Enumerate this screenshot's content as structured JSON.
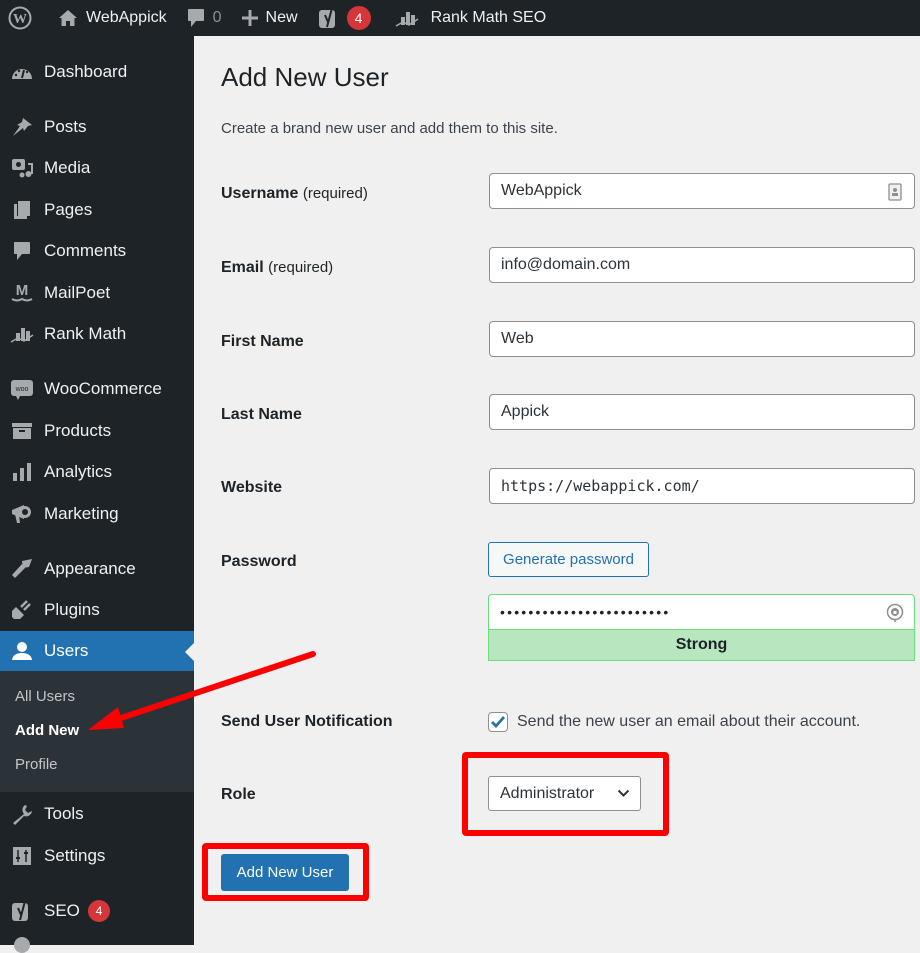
{
  "adminbar": {
    "site_name": "WebAppick",
    "comments_count": "0",
    "new_label": "New",
    "yoast_badge": "4",
    "rank_math_label": "Rank Math SEO"
  },
  "sidebar": {
    "items": [
      {
        "label": "Dashboard",
        "icon": "dashboard-icon"
      },
      {
        "label": "Posts",
        "icon": "pin-icon"
      },
      {
        "label": "Media",
        "icon": "media-icon"
      },
      {
        "label": "Pages",
        "icon": "pages-icon"
      },
      {
        "label": "Comments",
        "icon": "comment-icon"
      },
      {
        "label": "MailPoet",
        "icon": "mailpoet-icon"
      },
      {
        "label": "Rank Math",
        "icon": "rank-math-icon"
      },
      {
        "label": "WooCommerce",
        "icon": "woo-icon"
      },
      {
        "label": "Products",
        "icon": "archive-icon"
      },
      {
        "label": "Analytics",
        "icon": "bar-chart-icon"
      },
      {
        "label": "Marketing",
        "icon": "megaphone-icon"
      },
      {
        "label": "Appearance",
        "icon": "brush-icon"
      },
      {
        "label": "Plugins",
        "icon": "plug-icon"
      },
      {
        "label": "Users",
        "icon": "user-icon"
      },
      {
        "label": "Tools",
        "icon": "wrench-icon"
      },
      {
        "label": "Settings",
        "icon": "sliders-icon"
      },
      {
        "label": "SEO",
        "icon": "yoast-icon",
        "badge": "4"
      }
    ],
    "users_submenu": [
      "All Users",
      "Add New",
      "Profile"
    ],
    "active_item": "Users",
    "current_subitem": "Add New"
  },
  "page": {
    "title": "Add New User",
    "description": "Create a brand new user and add them to this site."
  },
  "form": {
    "required_suffix": "(required)",
    "username": {
      "label": "Username",
      "value": "WebAppick"
    },
    "email": {
      "label": "Email",
      "value": "info@domain.com"
    },
    "first_name": {
      "label": "First Name",
      "value": "Web"
    },
    "last_name": {
      "label": "Last Name",
      "value": "Appick"
    },
    "website": {
      "label": "Website",
      "value": "https://webappick.com/"
    },
    "password": {
      "label": "Password",
      "generate_label": "Generate password",
      "masked_value": "••••••••••••••••••••••••",
      "strength": "Strong"
    },
    "notification": {
      "label": "Send User Notification",
      "checkbox_label": "Send the new user an email about their account.",
      "checked": true
    },
    "role": {
      "label": "Role",
      "selected": "Administrator"
    },
    "submit_label": "Add New User"
  },
  "colors": {
    "accent": "#2271b1",
    "sidebar_bg": "#1d2327",
    "strength_bg": "#b8e6bf",
    "annotation": "#ff0000",
    "badge": "#d63638"
  }
}
